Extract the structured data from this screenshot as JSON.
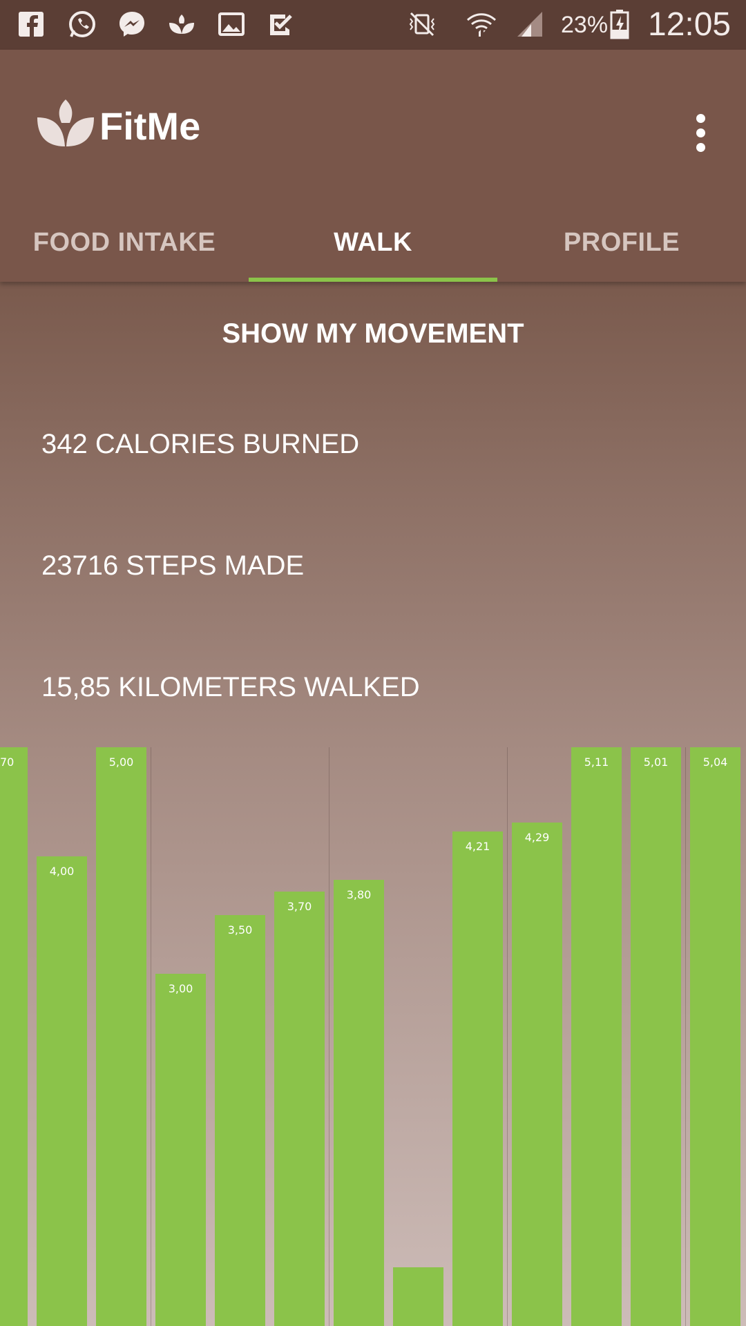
{
  "status_bar": {
    "icons_left": [
      "facebook-icon",
      "whatsapp-icon",
      "messenger-icon",
      "fitme-icon",
      "gallery-icon",
      "checkmark-icon"
    ],
    "icons_right": [
      "vibrate-mute-icon",
      "wifi-icon",
      "signal-icon",
      "battery-charging-icon"
    ],
    "battery": "23%",
    "time": "12:05"
  },
  "app": {
    "title": "FitMe",
    "menu_icon": "more-vert-icon"
  },
  "tabs": [
    {
      "label": "FOOD INTAKE",
      "active": false
    },
    {
      "label": "WALK",
      "active": true
    },
    {
      "label": "PROFILE",
      "active": false
    }
  ],
  "walk": {
    "section_title": "SHOW MY MOVEMENT",
    "calories": "342 CALORIES BURNED",
    "steps": "23716 STEPS MADE",
    "distance": "15,85 KILOMETERS WALKED"
  },
  "colors": {
    "accent": "#8bc34a",
    "status_bar": "#5b3e35",
    "app_bar": "#79564a"
  },
  "chart_data": {
    "type": "bar",
    "title": "",
    "xlabel": "",
    "ylabel": "",
    "grid": "vertical lines",
    "labels": [
      "70",
      "4,00",
      "5,00",
      "3,00",
      "3,50",
      "3,70",
      "3,80",
      "",
      "4,21",
      "4,29",
      "5,11",
      "5,01",
      "5,04"
    ],
    "values": [
      5.7,
      4.0,
      5.0,
      3.0,
      3.5,
      3.7,
      3.8,
      0.5,
      4.21,
      4.29,
      5.11,
      5.01,
      5.04
    ],
    "ylim": [
      0,
      7.0
    ]
  }
}
